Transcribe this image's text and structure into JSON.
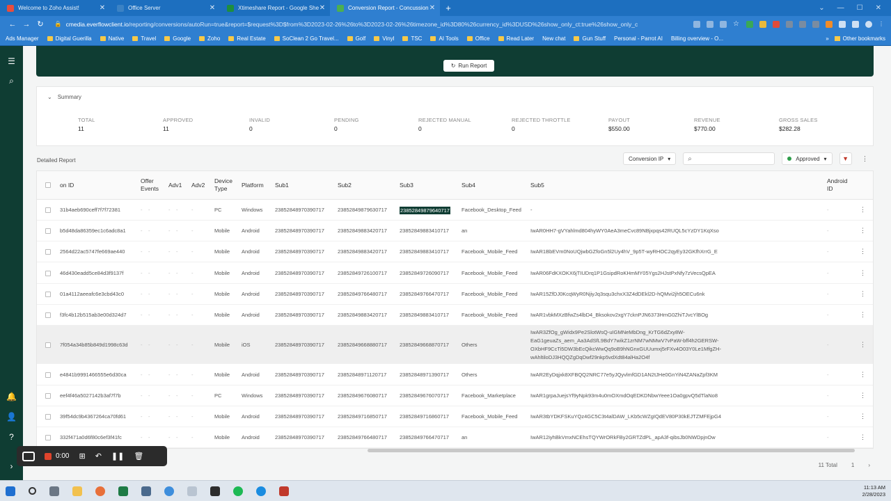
{
  "browser": {
    "tabs": [
      {
        "title": "Welcome to Zoho Assist!",
        "favicon_color": "#e84d3d",
        "active": false
      },
      {
        "title": "Office Server",
        "favicon_color": "#3b82c4",
        "active": false
      },
      {
        "title": "Xtimeshare Report - Google She",
        "favicon_color": "#1e8e3e",
        "active": false
      },
      {
        "title": "Conversion Report - Concussion",
        "favicon_color": "#4caf50",
        "active": true
      }
    ],
    "new_tab": "+",
    "url_host": "cmedia.everflowclient.io",
    "url_path": "/reporting/conversions/autoRun=true&report=$request%3D$from%3D2023-02-26%26to%3D2023-02-26%26timezone_id%3D80%26currency_id%3DUSD%26show_only_ct:true%26show_only_c",
    "bookmarks": [
      "Ads Manager",
      "Digital Guerilla",
      "Native",
      "Travel",
      "Google",
      "Zoho",
      "Real Estate",
      "SoClean 2 Go Travel...",
      "Golf",
      "Vinyl",
      "TSC",
      "AI Tools",
      "Office",
      "Read Later",
      "New chat",
      "Gun Stuff",
      "Personal - Parrot AI",
      "Billing overview - O..."
    ],
    "other_bookmarks": "Other bookmarks"
  },
  "page": {
    "run_report_label": "Run Report",
    "summary": {
      "title": "Summary",
      "stats": [
        {
          "label": "TOTAL",
          "value": "11"
        },
        {
          "label": "APPROVED",
          "value": "11"
        },
        {
          "label": "INVALID",
          "value": "0"
        },
        {
          "label": "PENDING",
          "value": "0"
        },
        {
          "label": "REJECTED MANUAL",
          "value": "0"
        },
        {
          "label": "REJECTED THROTTLE",
          "value": "0"
        },
        {
          "label": "PAYOUT",
          "value": "$550.00"
        },
        {
          "label": "REVENUE",
          "value": "$770.00"
        },
        {
          "label": "GROSS SALES",
          "value": "$282.28"
        }
      ]
    },
    "detailed_report_label": "Detailed Report",
    "filters": {
      "conversion_ip": "Conversion IP",
      "search_placeholder": "",
      "status": "Approved"
    },
    "columns": [
      "on ID",
      "Offer Events",
      "Adv1",
      "Adv2",
      "Device Type",
      "Platform",
      "Sub1",
      "Sub2",
      "Sub3",
      "Sub4",
      "Sub5",
      "Android ID"
    ],
    "rows": [
      {
        "id": "31b4aeb690ceff7f7f72381",
        "device": "PC",
        "platform": "Windows",
        "sub1": "23852848970390717",
        "sub2": "23852849879630717",
        "sub3": "23852849879640717",
        "sub4": "Facebook_Desktop_Feed",
        "sub5": "-"
      },
      {
        "id": "b5d48da86359ec1c6adc8a1",
        "device": "Mobile",
        "platform": "Android",
        "sub1": "23852848970390717",
        "sub2": "23852849883420717",
        "sub3": "23852849883410717",
        "sub4": "an",
        "sub5": "IwAR0HH7-gVYahlmd804hyWY0AeA3meCvc89NBjxpqs42RUQL5cYzDY1KqXso"
      },
      {
        "id": "2564d22ac5747fe669ae440",
        "device": "Mobile",
        "platform": "Android",
        "sub1": "23852848970390717",
        "sub2": "23852849883420717",
        "sub3": "23852849883410717",
        "sub4": "Facebook_Mobile_Feed",
        "sub5": "IwAR1BbEVm0NoUQjwbGZfoGn5l2Uy4hV_9p5T-wyRHOC2qyEy32GKfhXrrG_E"
      },
      {
        "id": "46d430eadd5ce84d3f9137f",
        "device": "Mobile",
        "platform": "Android",
        "sub1": "23852848970390717",
        "sub2": "23852849726100717",
        "sub3": "23852849726090717",
        "sub4": "Facebook_Mobile_Feed",
        "sub5": "IwAR06FdKXOKX6jTIUDrq1P1GsipdRoKHmMY05Ygs2HJstPxNfy7zVecsQpEA"
      },
      {
        "id": "01a4112aeeafc6e3cbd43c0",
        "device": "Mobile",
        "platform": "Android",
        "sub1": "23852848970390717",
        "sub2": "23852849766480717",
        "sub3": "23852849766470717",
        "sub4": "Facebook_Mobile_Feed",
        "sub5": "IwAR15ZfDJ0KcqWyR0NjiyJq3squ3chxX3Z4dDEkl2D-hQMvi2jh5OECu6nk"
      },
      {
        "id": "f3fc4b12b515ab3e00d324d7",
        "device": "Mobile",
        "platform": "Android",
        "sub1": "23852848970390717",
        "sub2": "23852849883420717",
        "sub3": "23852849883410717",
        "sub4": "Facebook_Mobile_Feed",
        "sub5": "IwAR1vbkMXzBfwZs4lbD4_Bksokov2xgY7cknPJN6373HmG0ZhiTJvcYlBOg"
      },
      {
        "id": "7f054a34b85b849d1998c63d",
        "device": "Mobile",
        "platform": "iOS",
        "sub1": "23852848970390717",
        "sub2": "23852849668880717",
        "sub3": "23852849668870717",
        "sub4": "Others",
        "sub5": "IwAR3ZfOg_gWidx9Pe2SlotWsQ-uIGMNeMbDng_KrTG6dZxy8W-EaG1geuaZs_aem_Aa3AdSfL9BdY7wikZ1zrNM7wNMwV7vPaW-bff4h2GERSW-OXbHF9CcTi5DW3bEcQikcWwQq9oB9hNGnxGUUumxj5rFXv4O03Y0Le1MfgZH-wAhltiloDJ3HQQZgDqDwf29nkp5vdXdt84alHa2O4f"
      },
      {
        "id": "e4841b9991466555e6d30ca",
        "device": "Mobile",
        "platform": "Android",
        "sub1": "23852848970390717",
        "sub2": "23852848971120717",
        "sub3": "23852848971390717",
        "sub4": "Others",
        "sub5": "IwAR2EyDqjxk8XFBQQ2NRC77e5yJQyvlmfGD1AN2tJHe0GnYiN4ZANaZpf3KM"
      },
      {
        "id": "eef4f46a5027142b3af7f7b",
        "device": "PC",
        "platform": "Windows",
        "sub1": "23852848970390717",
        "sub2": "23852849676080717",
        "sub3": "23852849676070717",
        "sub4": "Facebook_Marketplace",
        "sub5": "IwAR1grpaJuejsYf9yNpk93m4u0mOXmdOqEDKDNbwYeee1Oa0gpvQ5dTlaNo8"
      },
      {
        "id": "39f54dc9b4367264ca70fd61",
        "device": "Mobile",
        "platform": "Android",
        "sub1": "23852848970390717",
        "sub2": "23852849716850717",
        "sub3": "23852849716860717",
        "sub4": "Facebook_Mobile_Feed",
        "sub5": "IwAR3tbYDKFSKuYQz4GC5C3t4alDAW_LKb5cWZgIQdEV80P30kEJTZMFEjpG4"
      },
      {
        "id": "332f471a0d6f80c6ef3f41fc",
        "device": "Mobile",
        "platform": "Android",
        "sub1": "23852848970390717",
        "sub2": "23852849766480717",
        "sub3": "23852849766470717",
        "sub4": "an",
        "sub5": "IwAR12iyhBkVmxNCEhsTQYWrORkFBy2GRTZdPL_apA3f-qibsJb0NWDpjnOw"
      }
    ],
    "footer": {
      "total": "11 Total",
      "page": "1"
    }
  },
  "recorder": {
    "time": "0:00"
  },
  "taskbar": {
    "time": "11:13 AM",
    "date": "2/28/2023"
  }
}
